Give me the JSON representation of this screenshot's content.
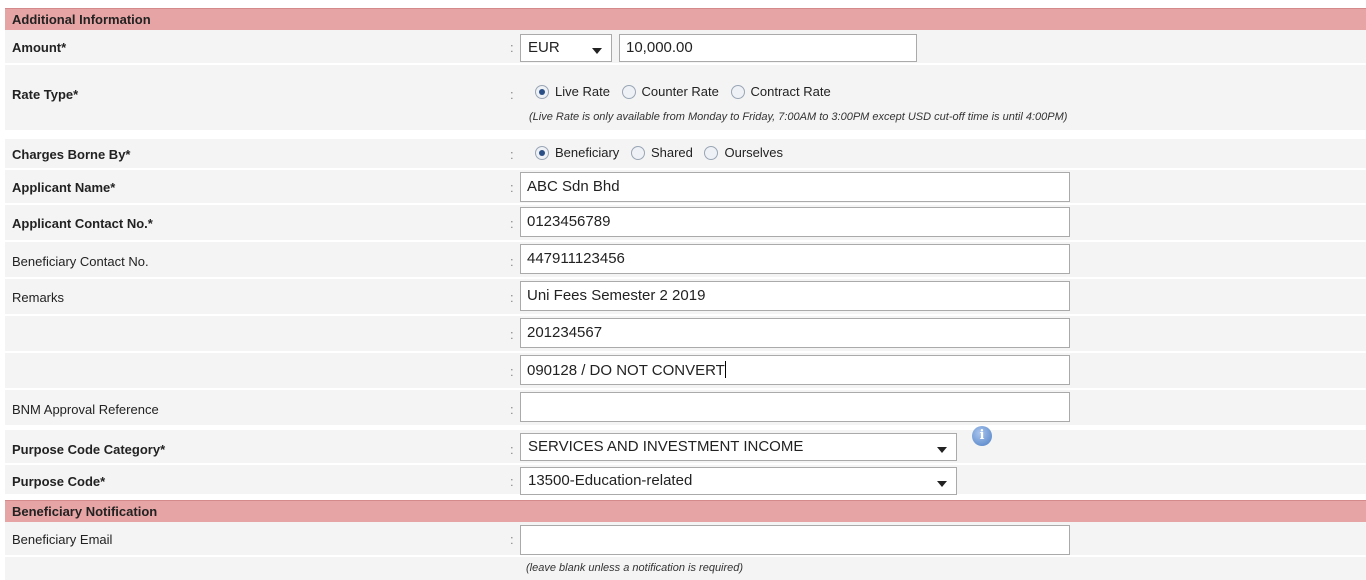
{
  "sections": {
    "additional": "Additional Information",
    "notification": "Beneficiary Notification"
  },
  "separator": ":",
  "amount": {
    "label": "Amount*",
    "currency": "EUR",
    "value": "10,000.00"
  },
  "rate_type": {
    "label": "Rate Type*",
    "options": [
      "Live Rate",
      "Counter Rate",
      "Contract Rate"
    ],
    "selected": "Live Rate",
    "note": "(Live Rate is only available from Monday to Friday, 7:00AM to 3:00PM except USD cut-off time is until 4:00PM)"
  },
  "charges": {
    "label": "Charges Borne By*",
    "options": [
      "Beneficiary",
      "Shared",
      "Ourselves"
    ],
    "selected": "Beneficiary"
  },
  "applicant_name": {
    "label": "Applicant Name*",
    "value": "ABC Sdn Bhd"
  },
  "applicant_contact": {
    "label": "Applicant Contact No.*",
    "value": "0123456789"
  },
  "beneficiary_contact": {
    "label": "Beneficiary Contact No.",
    "value": "447911123456"
  },
  "remarks": {
    "label": "Remarks",
    "line1": "Uni Fees Semester 2 2019",
    "line2": "201234567",
    "line3": "090128 / DO NOT CONVERT"
  },
  "bnm": {
    "label": "BNM Approval Reference",
    "value": ""
  },
  "purpose_category": {
    "label": "Purpose Code Category*",
    "value": "SERVICES AND INVESTMENT INCOME"
  },
  "purpose_code": {
    "label": "Purpose Code*",
    "value": "13500-Education-related"
  },
  "beneficiary_email": {
    "label": "Beneficiary Email",
    "value": "",
    "note": "(leave blank unless a notification is required)"
  },
  "icons": {
    "info": "info-icon",
    "dropdown": "chevron-down-icon",
    "radio": "radio-icon"
  }
}
